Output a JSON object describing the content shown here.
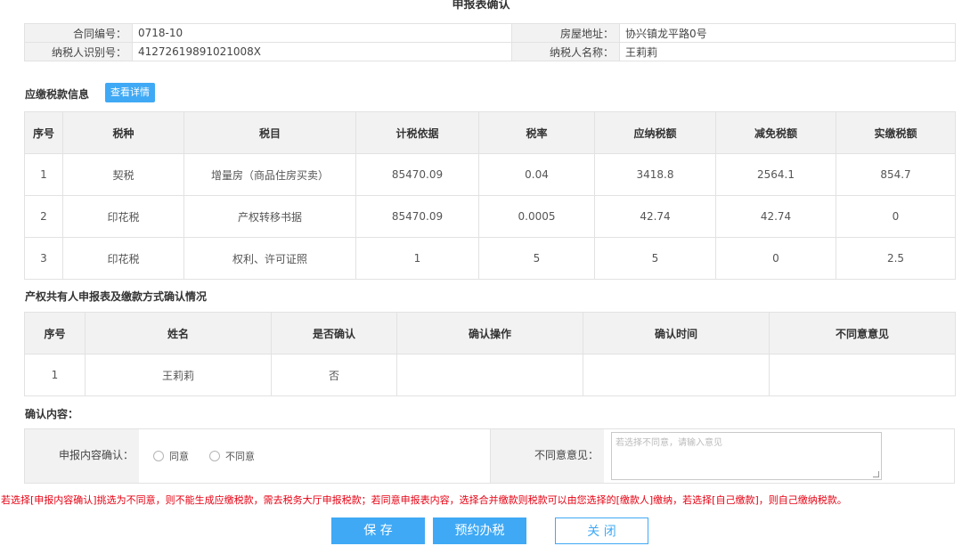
{
  "page": {
    "title": "申报表确认"
  },
  "info": {
    "contract_no_label": "合同编号：",
    "contract_no": "0718-10",
    "address_label": "房屋地址：",
    "address": "协兴镇龙平路0号",
    "taxpayer_id_label": "纳税人识别号：",
    "taxpayer_id": "41272619891021008X",
    "taxpayer_name_label": "纳税人名称：",
    "taxpayer_name": "王莉莉"
  },
  "tax_section": {
    "title": "应缴税款信息",
    "detail_button": "查看详情",
    "headers": [
      "序号",
      "税种",
      "税目",
      "计税依据",
      "税率",
      "应纳税额",
      "减免税额",
      "实缴税额"
    ],
    "rows": [
      [
        "1",
        "契税",
        "增量房（商品住房买卖）",
        "85470.09",
        "0.04",
        "3418.8",
        "2564.1",
        "854.7"
      ],
      [
        "2",
        "印花税",
        "产权转移书据",
        "85470.09",
        "0.0005",
        "42.74",
        "42.74",
        "0"
      ],
      [
        "3",
        "印花税",
        "权利、许可证照",
        "1",
        "5",
        "5",
        "0",
        "2.5"
      ]
    ]
  },
  "owner_section": {
    "title": "产权共有人申报表及缴款方式确认情况",
    "headers": [
      "序号",
      "姓名",
      "是否确认",
      "确认操作",
      "确认时间",
      "不同意意见"
    ],
    "rows": [
      [
        "1",
        "王莉莉",
        "否",
        "",
        "",
        ""
      ]
    ]
  },
  "confirm_section": {
    "title": "确认内容：",
    "content_label": "申报内容确认：",
    "agree_label": "同意",
    "disagree_label": "不同意",
    "reason_label": "不同意意见：",
    "reason_placeholder": "若选择不同意，请输入意见"
  },
  "notice": "若选择[申报内容确认]挑选为不同意，则不能生成应缴税款，需去税务大厅申报税款；若同意申报表内容，选择合并缴款则税款可以由您选择的[缴款人]缴纳，若选择[自己缴款]，则自己缴纳税款。",
  "buttons": {
    "save": "保 存",
    "reserve": "预约办税",
    "close": "关 闭"
  },
  "colors": {
    "accent": "#3fa9f5",
    "notice": "#e60012",
    "header_bg": "#f2f2f2"
  }
}
